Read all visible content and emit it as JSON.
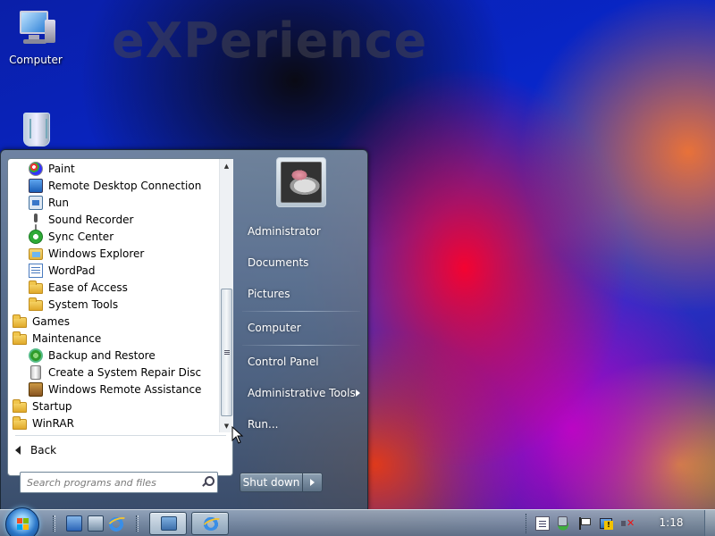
{
  "wallpaper": {
    "text": "eXPerience"
  },
  "desktop": {
    "icons": [
      {
        "label": "Computer",
        "icon": "computer-icon"
      },
      {
        "label": "",
        "icon": "recycle-bin-icon"
      }
    ]
  },
  "start_menu": {
    "programs": [
      {
        "label": "Paint",
        "icon": "paint-icon",
        "indent": 1
      },
      {
        "label": "Remote Desktop Connection",
        "icon": "remote-desktop-icon",
        "indent": 1
      },
      {
        "label": "Run",
        "icon": "run-icon",
        "indent": 1
      },
      {
        "label": "Sound Recorder",
        "icon": "microphone-icon",
        "indent": 1
      },
      {
        "label": "Sync Center",
        "icon": "sync-center-icon",
        "indent": 1
      },
      {
        "label": "Windows Explorer",
        "icon": "explorer-icon",
        "indent": 1
      },
      {
        "label": "WordPad",
        "icon": "wordpad-icon",
        "indent": 1
      },
      {
        "label": "Ease of Access",
        "icon": "folder-icon",
        "indent": 1
      },
      {
        "label": "System Tools",
        "icon": "folder-icon",
        "indent": 1
      },
      {
        "label": "Games",
        "icon": "folder-icon",
        "indent": 0
      },
      {
        "label": "Maintenance",
        "icon": "folder-icon",
        "indent": 0
      },
      {
        "label": "Backup and Restore",
        "icon": "backup-icon",
        "indent": 1
      },
      {
        "label": "Create a System Repair Disc",
        "icon": "repair-disc-icon",
        "indent": 1
      },
      {
        "label": "Windows Remote Assistance",
        "icon": "remote-assistance-icon",
        "indent": 1
      },
      {
        "label": "Startup",
        "icon": "folder-icon",
        "indent": 0
      },
      {
        "label": "WinRAR",
        "icon": "folder-icon",
        "indent": 0
      }
    ],
    "back_label": "Back",
    "search_placeholder": "Search programs and files",
    "right_items": {
      "administrator": "Administrator",
      "documents": "Documents",
      "pictures": "Pictures",
      "computer": "Computer",
      "control_panel": "Control Panel",
      "admin_tools": "Administrative Tools",
      "run": "Run..."
    },
    "shutdown_label": "Shut down"
  },
  "taskbar": {
    "clock": "1:18",
    "quick_launch": [
      "show-desktop-icon",
      "switch-windows-icon",
      "internet-explorer-icon"
    ],
    "tasks": [
      "control-panel-icon",
      "internet-explorer-icon"
    ],
    "tray": [
      "action-center-doc-icon",
      "security-shield-icon",
      "flag-icon",
      "network-warning-icon",
      "volume-muted-icon"
    ]
  },
  "colors": {
    "accent": "#2d78c9",
    "taskbar": "#7f96ac"
  }
}
